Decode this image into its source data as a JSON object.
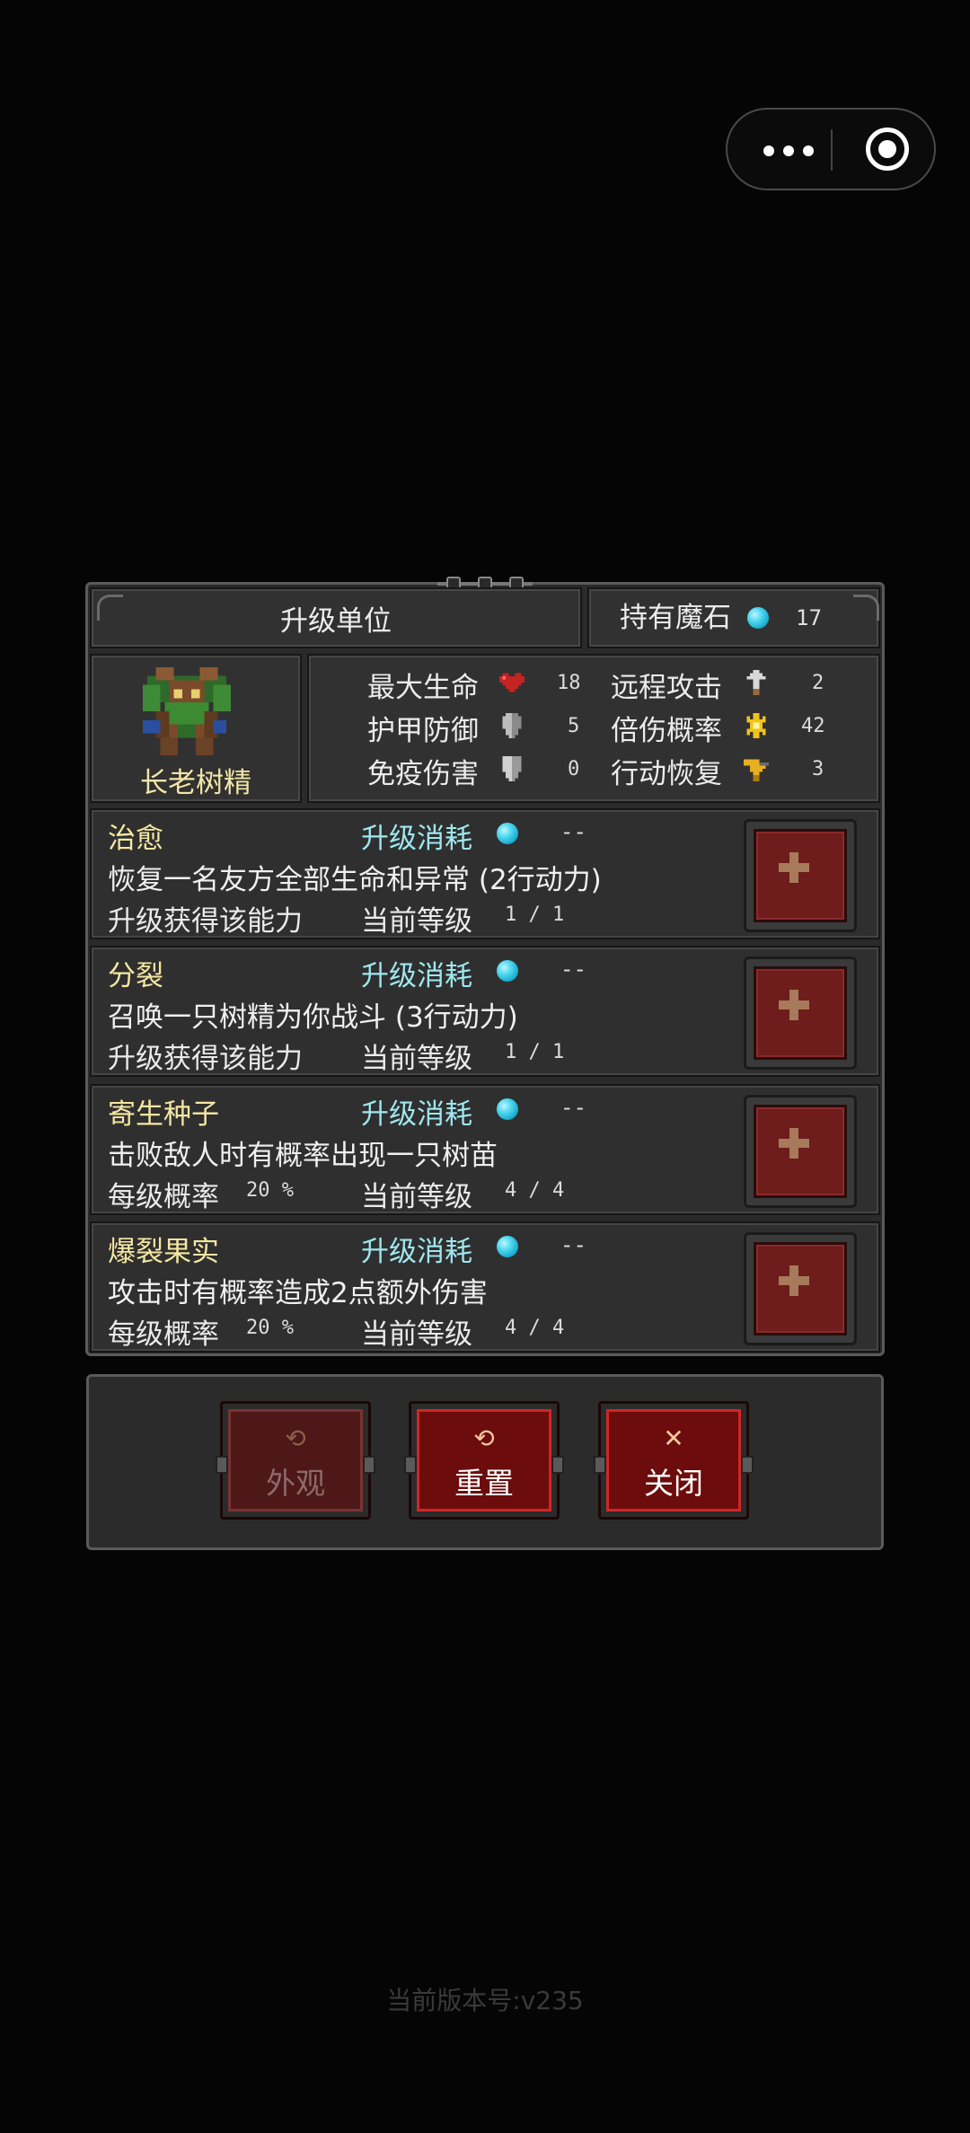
{
  "header": {
    "title": "升级单位",
    "stone_label": "持有魔石",
    "stone_count": "17"
  },
  "unit": {
    "name": "长老树精"
  },
  "stats": [
    {
      "label": "最大生命",
      "icon": "heart-icon",
      "value": "18"
    },
    {
      "label": "远程攻击",
      "icon": "arrow-icon",
      "value": "2"
    },
    {
      "label": "护甲防御",
      "icon": "shield-icon",
      "value": "5"
    },
    {
      "label": "倍伤概率",
      "icon": "star-icon",
      "value": "42"
    },
    {
      "label": "免疫伤害",
      "icon": "guard-icon",
      "value": "0"
    },
    {
      "label": "行动恢复",
      "icon": "boot-icon",
      "value": "3"
    }
  ],
  "abilities": [
    {
      "name": "治愈",
      "cost_label": "升级消耗",
      "cost": "--",
      "desc": "恢复一名友方全部生命和异常 (2行动力)",
      "line_label": "升级获得该能力",
      "line_value": "",
      "level_label": "当前等级",
      "level": "1 / 1"
    },
    {
      "name": "分裂",
      "cost_label": "升级消耗",
      "cost": "--",
      "desc": "召唤一只树精为你战斗 (3行动力)",
      "line_label": "升级获得该能力",
      "line_value": "",
      "level_label": "当前等级",
      "level": "1 / 1"
    },
    {
      "name": "寄生种子",
      "cost_label": "升级消耗",
      "cost": "--",
      "desc": "击败敌人时有概率出现一只树苗",
      "line_label": "每级概率",
      "line_value": "20 %",
      "level_label": "当前等级",
      "level": "4 / 4"
    },
    {
      "name": "爆裂果实",
      "cost_label": "升级消耗",
      "cost": "--",
      "desc": "攻击时有概率造成2点额外伤害",
      "line_label": "每级概率",
      "line_value": "20 %",
      "level_label": "当前等级",
      "level": "4 / 4"
    }
  ],
  "buttons": {
    "appearance": "外观",
    "reset": "重置",
    "close": "关闭"
  },
  "version": "当前版本号:v235",
  "colors": {
    "accent_red": "#d02626",
    "gem_cyan": "#13a6c9",
    "name_yellow": "#f5e7a2",
    "cost_cyan": "#9fe7ee"
  }
}
